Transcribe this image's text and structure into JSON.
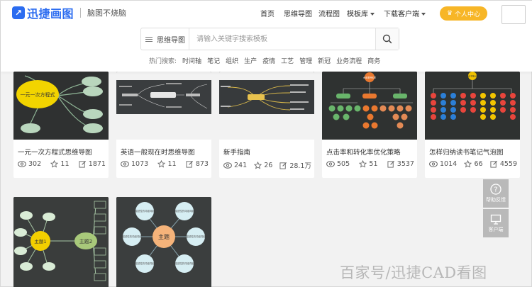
{
  "brand": {
    "name": "迅捷画图",
    "slogan": "脑图不烧脑",
    "accent": "#2b6cf0"
  },
  "nav": [
    {
      "label": "首页",
      "has_caret": false
    },
    {
      "label": "思维导图",
      "has_caret": false
    },
    {
      "label": "流程图",
      "has_caret": false
    },
    {
      "label": "模板库",
      "has_caret": true
    },
    {
      "label": "下载客户端",
      "has_caret": true
    }
  ],
  "user_center": {
    "label": "个人中心",
    "color": "#f7b627"
  },
  "search": {
    "category": "思维导图",
    "placeholder": "请输入关键字搜索模板",
    "icon": "search-icon"
  },
  "hot_search": {
    "label": "热门搜索:",
    "tags": [
      "时间轴",
      "笔记",
      "组织",
      "生产",
      "疫情",
      "工艺",
      "管理",
      "新冠",
      "业务流程",
      "商务"
    ]
  },
  "cards_row1": [
    {
      "title": "一元一次方程式思维导图",
      "views": "302",
      "likes": "11",
      "uses": "1871",
      "thumb_text": "一元一次方程式"
    },
    {
      "title": "英语一般现在时思维导图",
      "views": "1073",
      "likes": "11",
      "uses": "873"
    },
    {
      "title": "新手指南",
      "views": "241",
      "likes": "26",
      "uses": "28.1万"
    },
    {
      "title": "点击率和转化率优化策略",
      "views": "505",
      "likes": "51",
      "uses": "3537",
      "thumb_text": "点击率转化率"
    },
    {
      "title": "怎样归纳读书笔记气泡图",
      "views": "1014",
      "likes": "66",
      "uses": "4559",
      "thumb_text": "读书笔记"
    }
  ],
  "cards_row2": [
    {
      "center": "主题1",
      "side": "主题2"
    },
    {
      "center": "主题",
      "bubble": "描述性的词组词组"
    }
  ],
  "side_buttons": [
    {
      "label": "帮助反馈",
      "icon": "help-icon"
    },
    {
      "label": "客户端",
      "icon": "monitor-icon"
    }
  ],
  "watermark": "百家号/迅捷CAD看图"
}
